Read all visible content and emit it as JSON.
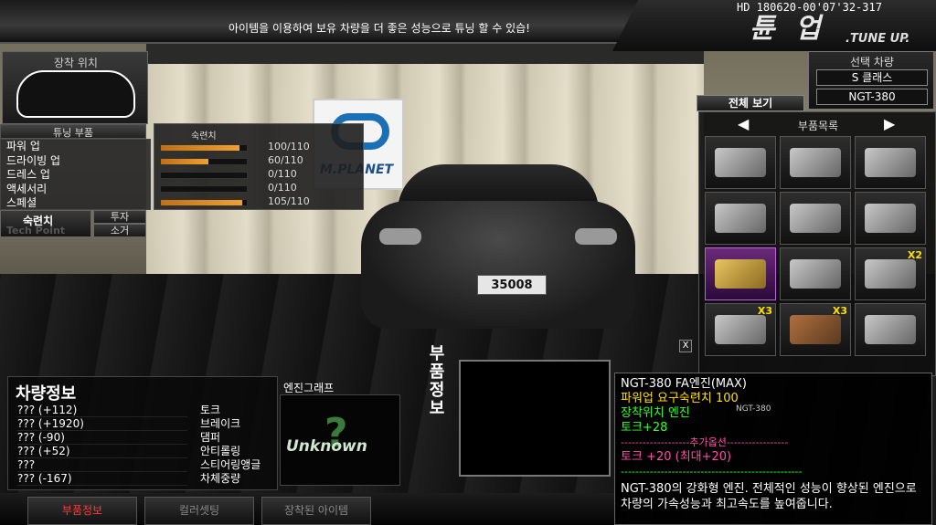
{
  "header": {
    "notice": "아이템을 이용하여 보유 차량을 더 좋은 성능으로 튜닝 할 수 있습!",
    "title_kor": "튠 업",
    "title_en": ".TUNE UP.",
    "hd_stamp": "HD 180620-00'07'32-317"
  },
  "left": {
    "mount_title": "장착 위치",
    "parts_title": "튜닝 부품",
    "parts": [
      "파워 업",
      "드라이빙 업",
      "드레스 업",
      "액세서리",
      "스페셜"
    ],
    "stats_head": "숙련치",
    "stats": [
      {
        "value": "100/110",
        "fill": 0.91
      },
      {
        "value": "60/110",
        "fill": 0.55
      },
      {
        "value": "0/110",
        "fill": 0
      },
      {
        "value": "0/110",
        "fill": 0
      },
      {
        "value": "105/110",
        "fill": 0.95
      }
    ],
    "skill_label": "숙련치",
    "skill_sub": "Tech Point",
    "btn_invest": "투자",
    "btn_consume": "소거"
  },
  "right": {
    "sel_title": "선택 차량",
    "sel_class": "S 클래스",
    "sel_model": "NGT-380",
    "view_all": "전체 보기",
    "inv_title": "부품목록",
    "prev": "◀",
    "next": "▶",
    "badges": [
      "",
      "",
      "",
      "",
      "",
      "",
      "",
      "",
      "X2",
      "X3",
      "X3",
      ""
    ]
  },
  "vehicle_info": {
    "title": "차량정보",
    "rows": [
      {
        "value": "??? (+112)",
        "key": "토크"
      },
      {
        "value": "??? (+1920)",
        "key": "브레이크"
      },
      {
        "value": "??? (-90)",
        "key": "댐퍼"
      },
      {
        "value": "??? (+52)",
        "key": "안티롤링"
      },
      {
        "value": "???",
        "key": "스티어링앵글"
      },
      {
        "value": "??? (-167)",
        "key": "차체중량"
      }
    ]
  },
  "engine_graph": {
    "title": "엔진그래프",
    "unknown": "Unknown",
    "mark": "?"
  },
  "part_info": {
    "label": "부품정보",
    "close": "X"
  },
  "tooltip": {
    "name": "NGT-380 FA엔진(MAX)",
    "req": "파워업 요구숙련치 100",
    "mount": "장착위치 엔진",
    "stat": "토크+28",
    "option_head": "-------------------추가옵션-----------------",
    "option": "토크 +20 (최대+20)",
    "divider": "--------------------------------------------------",
    "desc": "NGT-380의 강화형 엔진. 전체적인 성능이 향상된 엔진으로 차량의 가속성능과 최고속도를 높여줍니다.",
    "car_tag": "NGT-380"
  },
  "car": {
    "plate": "35008",
    "brand": "M.PLANET"
  },
  "tabs": [
    "부품정보",
    "컬러셋팅",
    "장착된 아이템"
  ],
  "colors": {
    "accent": "#f0a030",
    "yellow": "#ffe000",
    "green": "#32ff32",
    "pink": "#ff4fa8"
  }
}
